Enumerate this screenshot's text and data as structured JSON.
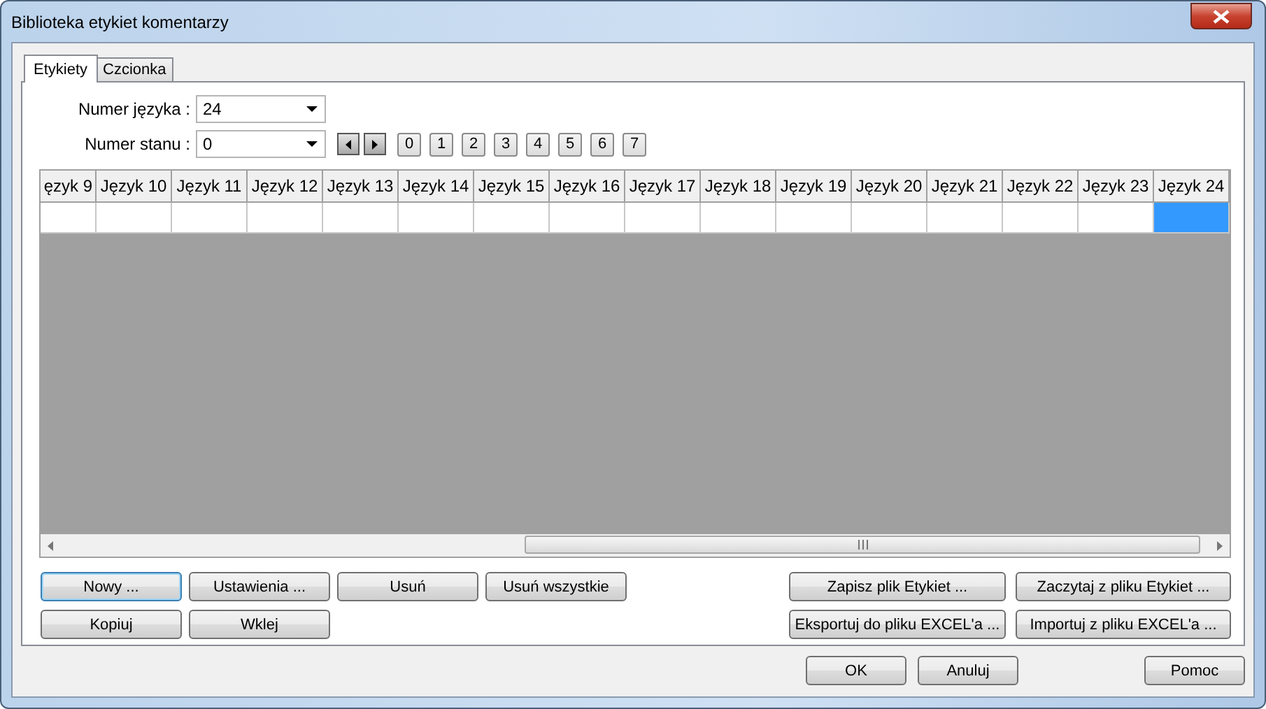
{
  "window": {
    "title": "Biblioteka etykiet komentarzy"
  },
  "tabs": [
    {
      "label": "Etykiety",
      "selected": true
    },
    {
      "label": "Czcionka",
      "selected": false
    }
  ],
  "language_number": {
    "label": "Numer języka :",
    "value": "24"
  },
  "state_number": {
    "label": "Numer stanu :",
    "value": "0"
  },
  "state_buttons": [
    "0",
    "1",
    "2",
    "3",
    "4",
    "5",
    "6",
    "7"
  ],
  "grid": {
    "columns": [
      "ęzyk 9",
      "Język 10",
      "Język 11",
      "Język 12",
      "Język 13",
      "Język 14",
      "Język 15",
      "Język 16",
      "Język 17",
      "Język 18",
      "Język 19",
      "Język 20",
      "Język 21",
      "Język 22",
      "Język 23",
      "Język 24"
    ],
    "rows": [
      {
        "cells": [
          {
            "selected": false
          },
          {
            "selected": false
          },
          {
            "selected": false
          },
          {
            "selected": false
          },
          {
            "selected": false
          },
          {
            "selected": false
          },
          {
            "selected": false
          },
          {
            "selected": false
          },
          {
            "selected": false
          },
          {
            "selected": false
          },
          {
            "selected": false
          },
          {
            "selected": false
          },
          {
            "selected": false
          },
          {
            "selected": false
          },
          {
            "selected": false
          },
          {
            "selected": true
          }
        ]
      }
    ]
  },
  "left_buttons": [
    {
      "label": "Nowy ...",
      "focused": true
    },
    {
      "label": "Ustawienia ...",
      "focused": false
    },
    {
      "label": "Usuń",
      "focused": false
    },
    {
      "label": "Usuń wszystkie",
      "focused": false
    },
    {
      "label": "Kopiuj",
      "focused": false
    },
    {
      "label": "Wklej",
      "focused": false
    }
  ],
  "right_buttons": [
    "Zapisz plik Etykiet ...",
    "Zaczytaj z pliku Etykiet ...",
    "Eksportuj do pliku EXCEL'a ...",
    "Importuj z pliku EXCEL'a ..."
  ],
  "dialog_buttons": [
    "OK",
    "Anuluj",
    "Pomoc"
  ]
}
